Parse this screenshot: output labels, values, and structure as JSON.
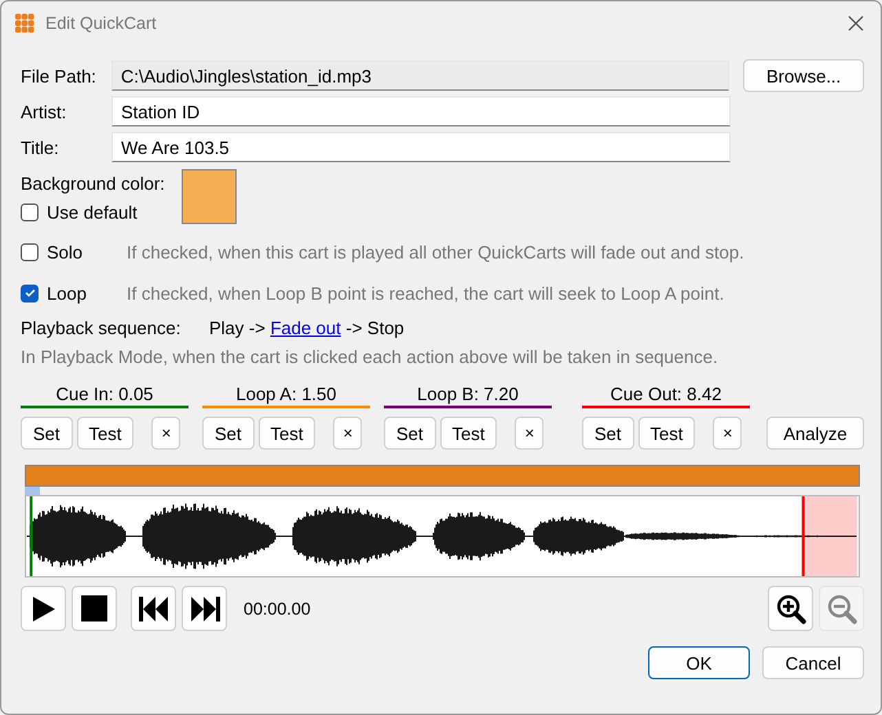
{
  "window": {
    "title": "Edit QuickCart"
  },
  "fields": [
    {
      "label": "File Path:",
      "value": "C:\\Audio\\Jingles\\station_id.mp3",
      "disabled": true
    },
    {
      "label": "Artist:",
      "value": "Station ID",
      "disabled": false
    },
    {
      "label": "Title:",
      "value": "We Are 103.5",
      "disabled": false
    }
  ],
  "browse_button": "Browse...",
  "background": {
    "label": "Background color:",
    "color": "#f5ae52",
    "use_default": {
      "label": "Use default",
      "checked": false
    }
  },
  "options": [
    {
      "label": "Solo",
      "checked": false,
      "hint": "If checked, when this cart is played all other QuickCarts will fade out and stop."
    },
    {
      "label": "Loop",
      "checked": true,
      "hint": "If checked, when Loop B point is reached, the cart will seek to Loop A point."
    }
  ],
  "playback": {
    "label": "Playback sequence:",
    "before": "Play ->",
    "link": "Fade out",
    "after": "-> Stop",
    "hint": "In Playback Mode, when the cart is clicked each action above will be taken in sequence."
  },
  "markers": [
    {
      "label": "Cue In: 0.05",
      "color": "#008000",
      "buttons": [
        "Set",
        "Test",
        "×"
      ]
    },
    {
      "label": "Loop A: 1.50",
      "color": "#ff8c00",
      "buttons": [
        "Set",
        "Test",
        "×"
      ]
    },
    {
      "label": "Loop B: 7.20",
      "color": "#800080",
      "buttons": [
        "Set",
        "Test",
        "×"
      ]
    },
    {
      "label": "Cue Out: 8.42",
      "color": "#ff0000",
      "buttons": [
        "Set",
        "Test",
        "×"
      ]
    }
  ],
  "analyze_button": "Analyze",
  "waveform": {
    "start_marker": {
      "level": 0.006
    },
    "end_marker": {
      "level": 0.935
    }
  },
  "transport": [
    {
      "kind": "play"
    },
    {
      "kind": "stop"
    },
    {
      "kind": "prev"
    },
    {
      "kind": "next"
    }
  ],
  "time": "00:00.00",
  "zoom": [
    {
      "kind": "in",
      "disabled": false
    },
    {
      "kind": "out",
      "disabled": true
    }
  ],
  "buttons": [
    {
      "label": "OK",
      "kind": "default"
    },
    {
      "label": "Cancel",
      "kind": "normal"
    }
  ]
}
